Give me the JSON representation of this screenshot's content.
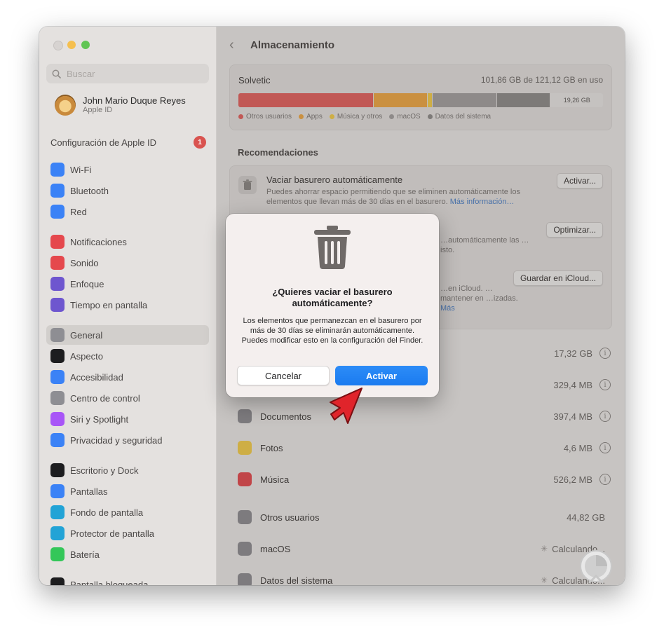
{
  "window": {
    "traffic_lights": {
      "close": "#ed6a5e",
      "minimize": "#f5bf4f",
      "zoom": "#61c554"
    }
  },
  "sidebar": {
    "search_placeholder": "Buscar",
    "user": {
      "name": "John Mario Duque Reyes",
      "subtitle": "Apple ID"
    },
    "apple_id_config": {
      "label": "Configuración de Apple ID",
      "badge": "1"
    },
    "items": [
      {
        "label": "Wi-Fi",
        "icon": "wifi-icon",
        "color": "#3b82f6"
      },
      {
        "label": "Bluetooth",
        "icon": "bluetooth-icon",
        "color": "#3b82f6"
      },
      {
        "label": "Red",
        "icon": "globe-icon",
        "color": "#3b82f6"
      },
      {
        "label": "Notificaciones",
        "icon": "bell-icon",
        "color": "#e5484d"
      },
      {
        "label": "Sonido",
        "icon": "speaker-icon",
        "color": "#e5484d"
      },
      {
        "label": "Enfoque",
        "icon": "moon-icon",
        "color": "#6e56cf"
      },
      {
        "label": "Tiempo en pantalla",
        "icon": "hourglass-icon",
        "color": "#6e56cf"
      },
      {
        "label": "General",
        "icon": "gear-icon",
        "color": "#8e8e93",
        "selected": true
      },
      {
        "label": "Aspecto",
        "icon": "appearance-icon",
        "color": "#1d1d1f"
      },
      {
        "label": "Accesibilidad",
        "icon": "accessibility-icon",
        "color": "#3b82f6"
      },
      {
        "label": "Centro de control",
        "icon": "control-center-icon",
        "color": "#8e8e93"
      },
      {
        "label": "Siri y Spotlight",
        "icon": "siri-icon",
        "color": "#a855f7"
      },
      {
        "label": "Privacidad y seguridad",
        "icon": "hand-icon",
        "color": "#3b82f6"
      },
      {
        "label": "Escritorio y Dock",
        "icon": "dock-icon",
        "color": "#1d1d1f"
      },
      {
        "label": "Pantallas",
        "icon": "display-icon",
        "color": "#3b82f6"
      },
      {
        "label": "Fondo de pantalla",
        "icon": "wallpaper-icon",
        "color": "#22a3d6"
      },
      {
        "label": "Protector de pantalla",
        "icon": "screensaver-icon",
        "color": "#22a3d6"
      },
      {
        "label": "Batería",
        "icon": "battery-icon",
        "color": "#34c759"
      },
      {
        "label": "Pantalla bloqueada",
        "icon": "lock-icon",
        "color": "#1d1d1f"
      }
    ]
  },
  "header": {
    "title": "Almacenamiento"
  },
  "storage": {
    "volume_name": "Solvetic",
    "usage_text": "101,86 GB de 121,12 GB en uso",
    "free_label": "19,26 GB",
    "segments": [
      {
        "name": "Otros usuarios",
        "color": "#e5605e",
        "fraction": 0.37
      },
      {
        "name": "Apps",
        "color": "#f0a843",
        "fraction": 0.145
      },
      {
        "name": "Música y otros",
        "color": "#f5cf4a",
        "fraction": 0.012
      },
      {
        "name": "macOS",
        "color": "#a3a1a0",
        "fraction": 0.175
      },
      {
        "name": "Datos del sistema",
        "color": "#8e8c8b",
        "fraction": 0.145
      }
    ]
  },
  "recommendations": {
    "title": "Recomendaciones",
    "items": [
      {
        "title": "Vaciar basurero automáticamente",
        "desc": "Puedes ahorrar espacio permitiendo que se eliminen automáticamente los elementos que llevan más de 30 días en el basurero.",
        "link": "Más información…",
        "button": "Activar..."
      },
      {
        "desc_visible": "…automáticamente las …isto.",
        "button": "Optimizar..."
      },
      {
        "desc_visible": "…en iCloud. …mantener en …izadas.",
        "link": "Más",
        "button": "Guardar en iCloud..."
      }
    ]
  },
  "categories": [
    {
      "label": "",
      "size": "17,32 GB",
      "icon": "apps-icon",
      "color": "#3b82f6",
      "info": true
    },
    {
      "label": "",
      "size": "329,4 MB",
      "icon": "books-icon",
      "color": "#f0a843",
      "info": true
    },
    {
      "label": "Documentos",
      "size": "397,4 MB",
      "icon": "document-icon",
      "color": "#8e8e93",
      "info": true
    },
    {
      "label": "Fotos",
      "size": "4,6 MB",
      "icon": "photos-icon",
      "color": "#f5cf4a",
      "info": true
    },
    {
      "label": "Música",
      "size": "526,2 MB",
      "icon": "music-icon",
      "color": "#e5484d",
      "info": true
    },
    {
      "label": "Otros usuarios",
      "size": "44,82 GB",
      "icon": "users-icon",
      "color": "#8e8e93",
      "info": false
    },
    {
      "label": "macOS",
      "size": "Calculando...",
      "icon": "macos-icon",
      "color": "#8e8e93",
      "info": false,
      "loading": true
    },
    {
      "label": "Datos del sistema",
      "size": "Calculando...",
      "icon": "system-data-icon",
      "color": "#8e8e93",
      "info": false,
      "loading": true
    }
  ],
  "dialog": {
    "icon": "trash-icon",
    "title": "¿Quieres vaciar el basurero automáticamente?",
    "body": "Los elementos que permanezcan en el basurero por más de 30 días se eliminarán automáticamente. Puedes modificar esto en la configuración del Finder.",
    "cancel_label": "Cancelar",
    "confirm_label": "Activar"
  }
}
